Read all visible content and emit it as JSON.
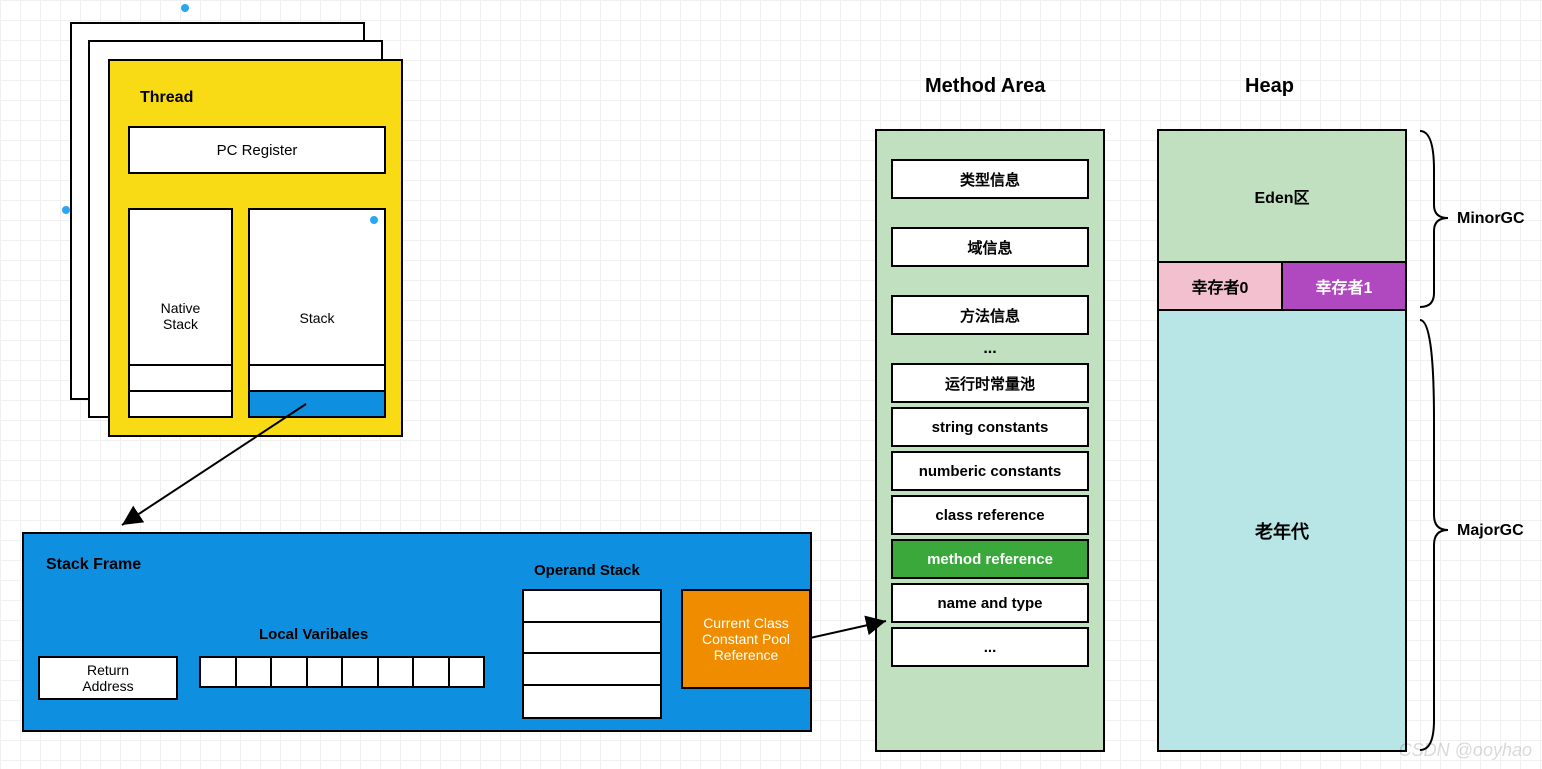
{
  "thread": {
    "title": "Thread",
    "pc_register": "PC Register",
    "native_stack_l1": "Native",
    "native_stack_l2": "Stack",
    "stack": "Stack"
  },
  "stack_frame": {
    "title": "Stack Frame",
    "return_l1": "Return",
    "return_l2": "Address",
    "local_vars": "Local Varibales",
    "operand_stack": "Operand Stack",
    "ccpr_l1": "Current Class",
    "ccpr_l2": "Constant Pool",
    "ccpr_l3": "Reference"
  },
  "method_area": {
    "title": "Method Area",
    "items_top": [
      "类型信息",
      "域信息",
      "方法信息"
    ],
    "dots": "...",
    "items_bottom": [
      "运行时常量池",
      "string constants",
      "numberic constants",
      "class reference",
      "method reference",
      "name and type",
      "..."
    ],
    "highlight_index": 4
  },
  "heap": {
    "title": "Heap",
    "eden": "Eden区",
    "surv0": "幸存者0",
    "surv1": "幸存者1",
    "old": "老年代"
  },
  "braces": {
    "minor": "MinorGC",
    "major": "MajorGC"
  },
  "watermark": "CSDN @ooyhao"
}
